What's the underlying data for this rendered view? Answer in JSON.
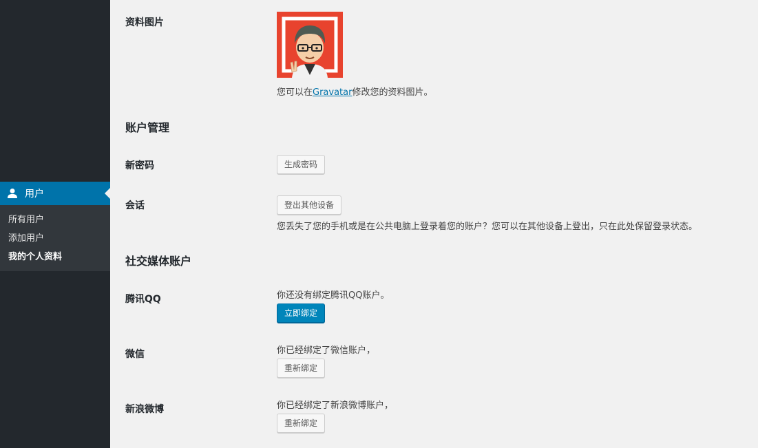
{
  "sidebar": {
    "active_menu": {
      "label": "用户",
      "icon": "user-icon"
    },
    "submenu": [
      {
        "label": "所有用户",
        "current": false
      },
      {
        "label": "添加用户",
        "current": false
      },
      {
        "label": "我的个人资料",
        "current": true
      }
    ]
  },
  "profile_picture": {
    "label": "资料图片",
    "hint_prefix": "您可以在",
    "hint_link": "Gravatar",
    "hint_suffix": "修改您的资料图片。"
  },
  "account": {
    "section_title": "账户管理",
    "new_password_label": "新密码",
    "generate_password_button": "生成密码",
    "sessions_label": "会话",
    "logout_others_button": "登出其他设备",
    "sessions_hint": "您丢失了您的手机或是在公共电脑上登录着您的账户？您可以在其他设备上登出，只在此处保留登录状态。"
  },
  "social": {
    "section_title": "社交媒体账户",
    "qq": {
      "label": "腾讯QQ",
      "status": "你还没有绑定腾讯QQ账户。",
      "button": "立即绑定"
    },
    "wechat": {
      "label": "微信",
      "status": "你已经绑定了微信账户，",
      "button": "重新绑定"
    },
    "weibo": {
      "label": "新浪微博",
      "status": "你已经绑定了新浪微博账户，",
      "button": "重新绑定"
    }
  },
  "colors": {
    "sidebar_bg": "#23282d",
    "submenu_bg": "#32373c",
    "accent": "#0073aa",
    "primary_button": "#0085ba",
    "avatar_frame": "#e8432e"
  }
}
